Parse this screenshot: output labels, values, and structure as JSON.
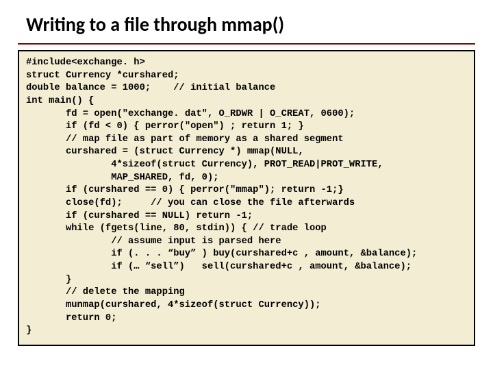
{
  "title": "Writing to a file through mmap()",
  "code": "#include<exchange. h>\nstruct Currency *curshared;\ndouble balance = 1000;    // initial balance\nint main() {\n       fd = open(\"exchange. dat\", O_RDWR | O_CREAT, 0600);\n       if (fd < 0) { perror(\"open\") ; return 1; }\n       // map file as part of memory as a shared segment\n       curshared = (struct Currency *) mmap(NULL,\n               4*sizeof(struct Currency), PROT_READ|PROT_WRITE,\n               MAP_SHARED, fd, 0);\n       if (curshared == 0) { perror(\"mmap\"); return -1;}\n       close(fd);     // you can close the file afterwards\n       if (curshared == NULL) return -1;\n       while (fgets(line, 80, stdin)) { // trade loop\n               // assume input is parsed here\n               if (. . . “buy” ) buy(curshared+c , amount, &balance);\n               if (… “sell”)   sell(curshared+c , amount, &balance);\n       }\n       // delete the mapping\n       munmap(curshared, 4*sizeof(struct Currency));\n       return 0;\n}"
}
